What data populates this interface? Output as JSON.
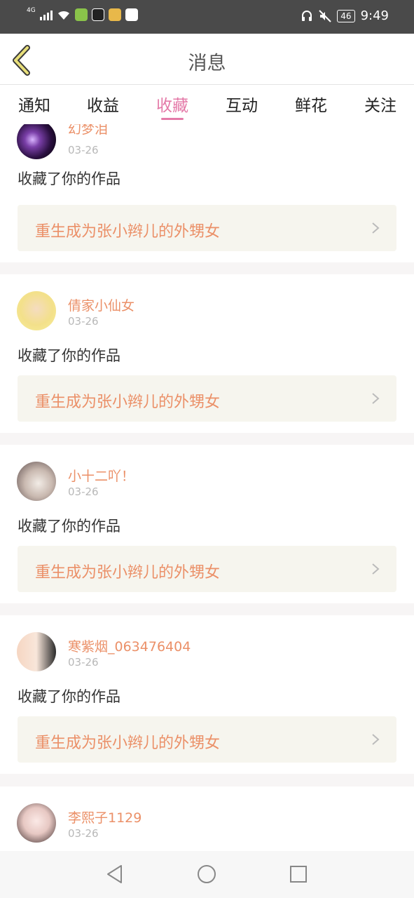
{
  "status_bar": {
    "network": "4G",
    "battery": "46",
    "time": "9:49"
  },
  "header": {
    "title": "消息"
  },
  "tabs": [
    {
      "label": "通知",
      "active": false
    },
    {
      "label": "收益",
      "active": false
    },
    {
      "label": "收藏",
      "active": true
    },
    {
      "label": "互动",
      "active": false
    },
    {
      "label": "鲜花",
      "active": false
    },
    {
      "label": "关注",
      "active": false
    }
  ],
  "messages": [
    {
      "user": "幻梦泪",
      "date": "03-26",
      "action": "收藏了你的作品",
      "work": "重生成为张小辫儿的外甥女"
    },
    {
      "user": "倩家小仙女",
      "date": "03-26",
      "action": "收藏了你的作品",
      "work": "重生成为张小辫儿的外甥女"
    },
    {
      "user": "小十二吖！",
      "date": "03-26",
      "action": "收藏了你的作品",
      "work": "重生成为张小辫儿的外甥女"
    },
    {
      "user": "寒紫烟_063476404",
      "date": "03-26",
      "action": "收藏了你的作品",
      "work": "重生成为张小辫儿的外甥女"
    },
    {
      "user": "李熙子1129",
      "date": "03-26"
    }
  ],
  "colors": {
    "accent": "#e47aa8",
    "username": "#eb9068",
    "work_bg": "#f6f5ee",
    "status_bar": "#4a4a4a"
  }
}
